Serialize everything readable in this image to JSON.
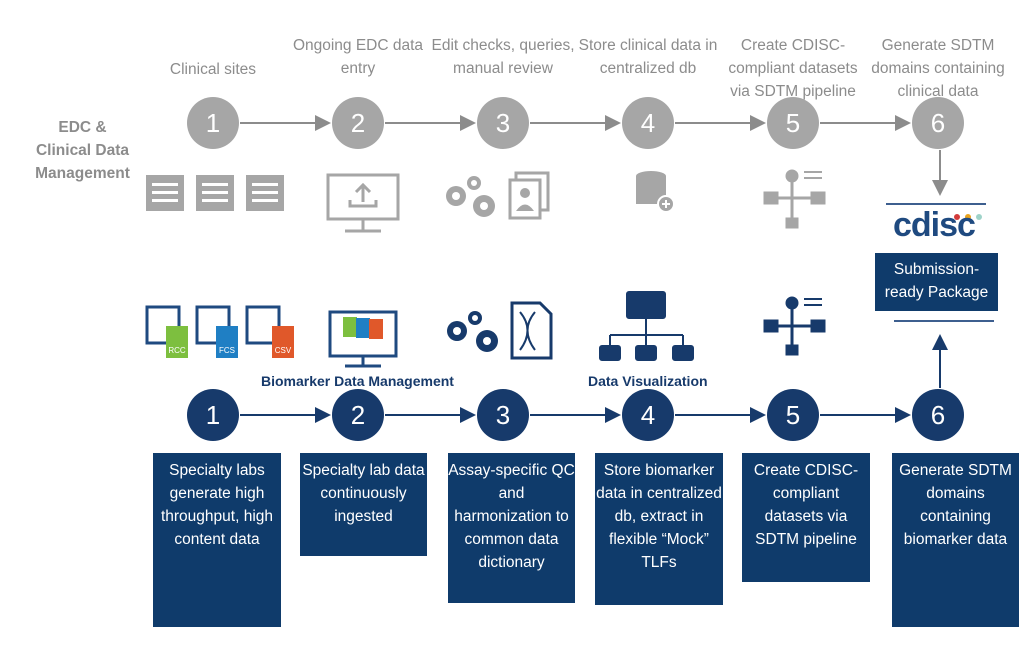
{
  "side_label": "EDC & Clinical Data Management",
  "top_steps": [
    {
      "num": "1",
      "label": "Clinical sites"
    },
    {
      "num": "2",
      "label": "Ongoing EDC data entry"
    },
    {
      "num": "3",
      "label": "Edit checks, queries, manual review"
    },
    {
      "num": "4",
      "label": "Store clinical data in centralized db"
    },
    {
      "num": "5",
      "label": "Create CDISC-compliant datasets via SDTM pipeline"
    },
    {
      "num": "6",
      "label": "Generate SDTM domains containing clinical data"
    }
  ],
  "bottom_steps": [
    {
      "num": "1",
      "label": "Specialty labs generate high throughput, high content data"
    },
    {
      "num": "2",
      "label": "Specialty lab data continuously ingested"
    },
    {
      "num": "3",
      "label": "Assay-specific QC and harmonization to common data dictionary"
    },
    {
      "num": "4",
      "label": "Store biomarker data in centralized db, extract in flexible “Mock” TLFs"
    },
    {
      "num": "5",
      "label": "Create CDISC-compliant datasets via SDTM pipeline"
    },
    {
      "num": "6",
      "label": "Generate SDTM domains containing biomarker data"
    }
  ],
  "sections": {
    "biomarker": "Biomarker Data Management",
    "visualization": "Data Visualization"
  },
  "file_types": [
    "RCC",
    "FCS",
    "CSV"
  ],
  "cdisc_logo": "cdisc",
  "submission": "Submission-ready Package",
  "colors": {
    "navy": "#0f3b6b",
    "gray": "#a6a6a6",
    "rcc": "#7dbf3f",
    "fcs": "#1f7fc4",
    "csv": "#e0582a"
  }
}
